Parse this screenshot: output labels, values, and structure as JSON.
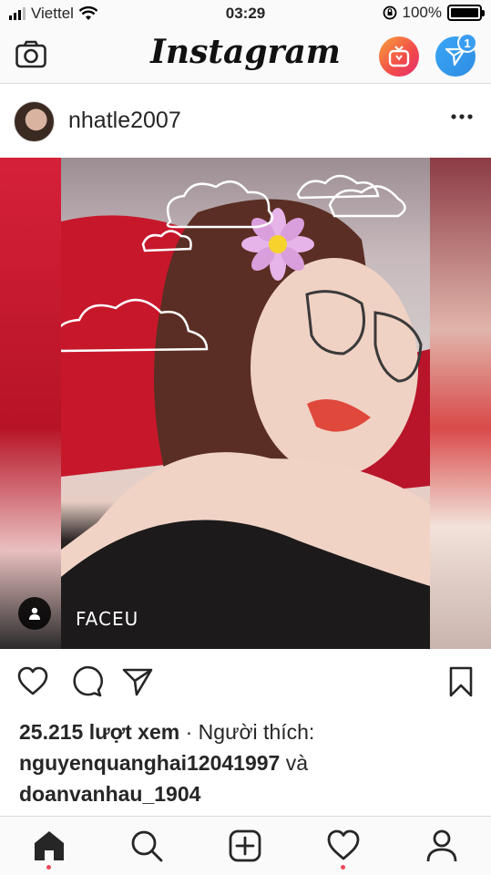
{
  "status_bar": {
    "carrier": "Viettel",
    "time": "03:29",
    "battery": "100%",
    "battery_level": 1.0
  },
  "top_nav": {
    "logo": "Instagram",
    "dm_badge": "1"
  },
  "post": {
    "username": "nhatle2007",
    "watermark": "FACEU",
    "views_count": "25.215 lượt xem",
    "separator": " · ",
    "liked_by_label": "Người thích:",
    "liker_1": "nguyenquanghai12041997",
    "conjunction": "và",
    "liker_2": "doanvanhau_1904"
  },
  "icons": {
    "camera": "camera-icon",
    "igtv": "igtv-icon",
    "direct": "direct-message-icon",
    "more": "more-options-icon",
    "like": "heart-icon",
    "comment": "comment-icon",
    "share": "share-icon",
    "save": "bookmark-icon",
    "home": "home-icon",
    "search": "search-icon",
    "add": "add-post-icon",
    "activity": "activity-heart-icon",
    "profile": "profile-icon",
    "tag": "user-tag-icon"
  },
  "colors": {
    "notification_dot": "#ed4956",
    "dm_blue": "#3a9df0",
    "igtv_orange": "#f14a4a"
  }
}
